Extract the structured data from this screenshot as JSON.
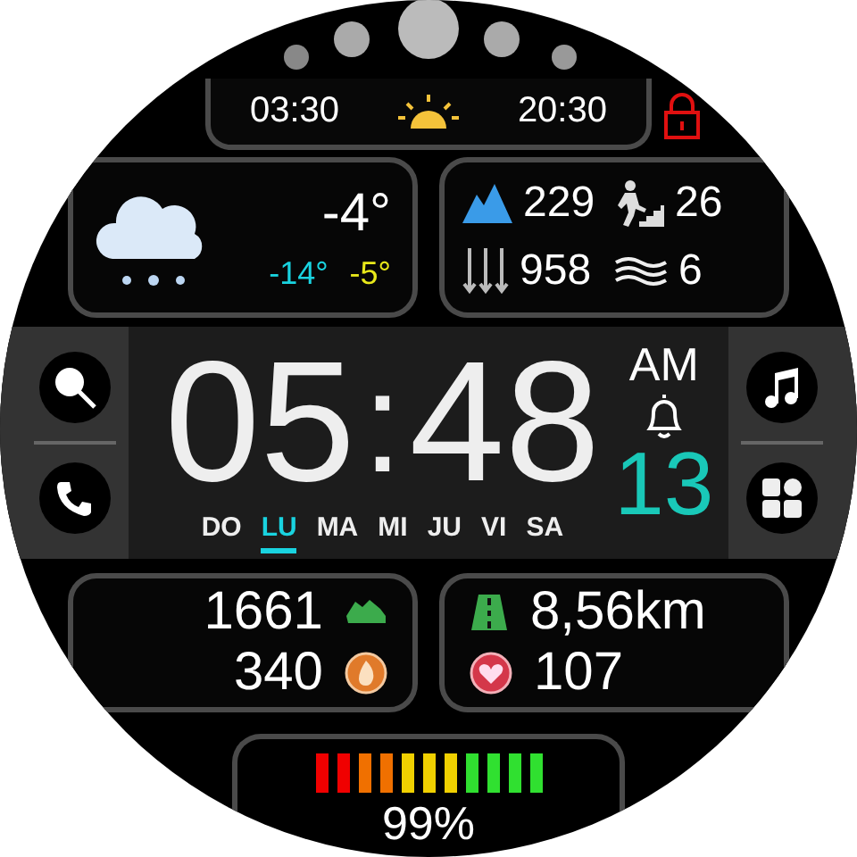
{
  "sun": {
    "sunrise": "03:30",
    "sunset": "20:30"
  },
  "weather": {
    "temperature": "-4°",
    "low": "-14°",
    "high": "-5°"
  },
  "stats": [
    {
      "kind": "altitude",
      "value": "229"
    },
    {
      "kind": "floors",
      "value": "26"
    },
    {
      "kind": "pressure",
      "value": "958"
    },
    {
      "kind": "wind",
      "value": "6"
    }
  ],
  "time": {
    "hours": "05",
    "separator": ":",
    "minutes": "48",
    "meridiem": "AM",
    "date": "13"
  },
  "days": [
    {
      "label": "DO",
      "selected": false
    },
    {
      "label": "LU",
      "selected": true
    },
    {
      "label": "MA",
      "selected": false
    },
    {
      "label": "MI",
      "selected": false
    },
    {
      "label": "JU",
      "selected": false
    },
    {
      "label": "VI",
      "selected": false
    },
    {
      "label": "SA",
      "selected": false
    }
  ],
  "activity_left": [
    {
      "kind": "steps",
      "value": "1661"
    },
    {
      "kind": "calories",
      "value": "340"
    }
  ],
  "activity_right": [
    {
      "kind": "distance",
      "value": "8,56km"
    },
    {
      "kind": "heart",
      "value": "107"
    }
  ],
  "battery": {
    "reading": "99%"
  }
}
